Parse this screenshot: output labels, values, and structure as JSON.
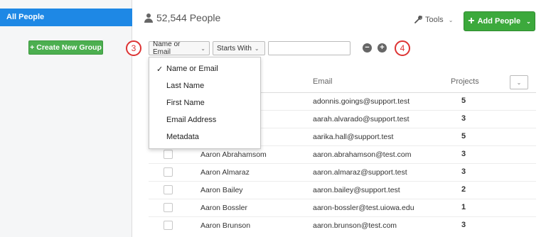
{
  "sidebar": {
    "active_item": "All People",
    "create_group_label": "Create New Group"
  },
  "header": {
    "people_count": "52,544 People",
    "tools_label": "Tools",
    "add_people_label": "Add People"
  },
  "filter": {
    "callout_left": "3",
    "callout_right": "4",
    "field_value": "Name or Email",
    "operator_value": "Starts With",
    "input_value": "",
    "dropdown_options": [
      {
        "label": "Name or Email",
        "selected": true
      },
      {
        "label": "Last Name",
        "selected": false
      },
      {
        "label": "First Name",
        "selected": false
      },
      {
        "label": "Email Address",
        "selected": false
      },
      {
        "label": "Metadata",
        "selected": false
      }
    ]
  },
  "table": {
    "columns": {
      "email": "Email",
      "projects": "Projects"
    },
    "rows": [
      {
        "name": "",
        "email": "adonnis.goings@support.test",
        "projects": "5"
      },
      {
        "name": "",
        "email": "aarah.alvarado@support.test",
        "projects": "3"
      },
      {
        "name": "",
        "email": "aarika.hall@support.test",
        "projects": "5"
      },
      {
        "name": "Aaron Abrahamsom",
        "email": "aaron.abrahamson@test.com",
        "projects": "3"
      },
      {
        "name": "Aaron Almaraz",
        "email": "aaron.almaraz@support.test",
        "projects": "3"
      },
      {
        "name": "Aaron Bailey",
        "email": "aaron.bailey@support.test",
        "projects": "2"
      },
      {
        "name": "Aaron Bossler",
        "email": "aaron-bossler@test.uiowa.edu",
        "projects": "1"
      },
      {
        "name": "Aaron Brunson",
        "email": "aaron.brunson@test.com",
        "projects": "3"
      }
    ]
  },
  "colors": {
    "sidebar_active": "#1e88e5",
    "primary_green": "#3ca93c",
    "callout_red": "#d33"
  }
}
